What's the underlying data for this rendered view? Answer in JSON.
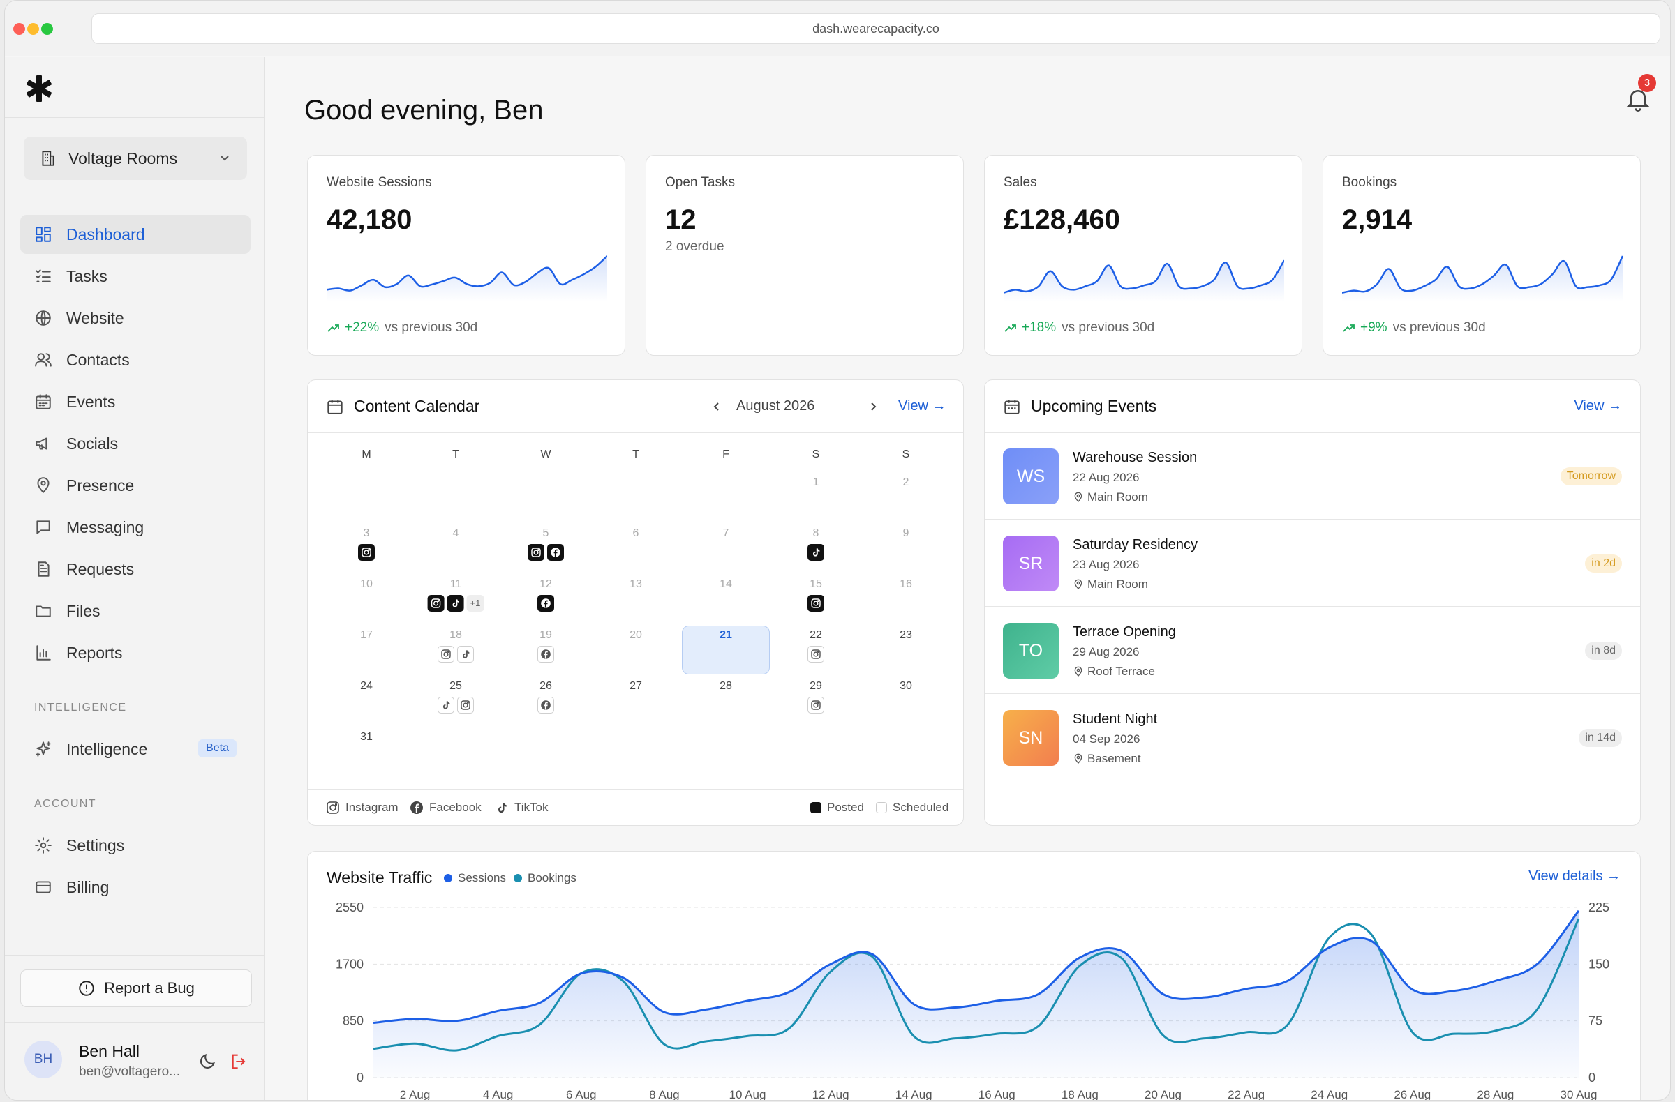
{
  "browser": {
    "url": "dash.wearecapacity.co"
  },
  "sidebar": {
    "workspace": "Voltage Rooms",
    "nav": [
      {
        "label": "Dashboard",
        "icon": "dashboard-icon",
        "active": true
      },
      {
        "label": "Tasks",
        "icon": "tasks-icon"
      },
      {
        "label": "Website",
        "icon": "globe-icon"
      },
      {
        "label": "Contacts",
        "icon": "users-icon"
      },
      {
        "label": "Events",
        "icon": "calendar-icon"
      },
      {
        "label": "Socials",
        "icon": "megaphone-icon"
      },
      {
        "label": "Presence",
        "icon": "map-pin-icon"
      },
      {
        "label": "Messaging",
        "icon": "message-icon"
      },
      {
        "label": "Requests",
        "icon": "document-icon"
      },
      {
        "label": "Files",
        "icon": "folder-icon"
      },
      {
        "label": "Reports",
        "icon": "bar-chart-icon"
      }
    ],
    "intelligence_heading": "INTELLIGENCE",
    "intelligence": {
      "label": "Intelligence",
      "badge": "Beta",
      "icon": "sparkle-icon"
    },
    "account_heading": "ACCOUNT",
    "account": [
      {
        "label": "Settings",
        "icon": "gear-icon"
      },
      {
        "label": "Billing",
        "icon": "credit-card-icon"
      }
    ],
    "report_bug": "Report a Bug",
    "user": {
      "initials": "BH",
      "name": "Ben Hall",
      "email": "ben@voltagero..."
    }
  },
  "header": {
    "greeting": "Good evening, Ben",
    "notifications": "3"
  },
  "kpis": [
    {
      "label": "Website Sessions",
      "value": "42,180",
      "change": "+22%",
      "suffix": "vs previous 30d",
      "spark": [
        0.22,
        0.25,
        0.2,
        0.32,
        0.45,
        0.28,
        0.35,
        0.55,
        0.3,
        0.34,
        0.42,
        0.5,
        0.35,
        0.3,
        0.38,
        0.62,
        0.33,
        0.4,
        0.6,
        0.72,
        0.35,
        0.45,
        0.58,
        0.75,
        1.0
      ]
    },
    {
      "label": "Open Tasks",
      "value": "12",
      "sub": "2 overdue"
    },
    {
      "label": "Sales",
      "value": "£128,460",
      "change": "+18%",
      "suffix": "vs previous 30d",
      "spark": [
        0.15,
        0.22,
        0.18,
        0.3,
        0.65,
        0.3,
        0.22,
        0.3,
        0.42,
        0.78,
        0.3,
        0.25,
        0.32,
        0.42,
        0.82,
        0.3,
        0.25,
        0.3,
        0.45,
        0.85,
        0.3,
        0.25,
        0.32,
        0.45,
        0.9
      ]
    },
    {
      "label": "Bookings",
      "value": "2,914",
      "change": "+9%",
      "suffix": "vs previous 30d",
      "spark": [
        0.15,
        0.2,
        0.18,
        0.35,
        0.7,
        0.25,
        0.2,
        0.3,
        0.45,
        0.75,
        0.3,
        0.25,
        0.35,
        0.55,
        0.8,
        0.3,
        0.28,
        0.35,
        0.58,
        0.88,
        0.3,
        0.28,
        0.32,
        0.45,
        1.0
      ]
    }
  ],
  "calendar": {
    "title": "Content Calendar",
    "month": "August 2026",
    "view": "View",
    "days_of_week": [
      "M",
      "T",
      "W",
      "T",
      "F",
      "S",
      "S"
    ],
    "today": 21,
    "posts": {
      "3": {
        "posted": [
          "instagram"
        ]
      },
      "5": {
        "posted": [
          "instagram",
          "facebook"
        ]
      },
      "8": {
        "posted": [
          "tiktok"
        ]
      },
      "11": {
        "posted": [
          "instagram",
          "tiktok"
        ],
        "more": "+1"
      },
      "12": {
        "posted": [
          "facebook"
        ]
      },
      "15": {
        "posted": [
          "instagram"
        ]
      },
      "18": {
        "scheduled": [
          "instagram",
          "tiktok"
        ]
      },
      "19": {
        "scheduled": [
          "facebook"
        ]
      },
      "22": {
        "scheduled": [
          "instagram"
        ]
      },
      "25": {
        "scheduled": [
          "tiktok",
          "instagram"
        ]
      },
      "26": {
        "scheduled": [
          "facebook"
        ]
      },
      "29": {
        "scheduled": [
          "instagram"
        ]
      }
    },
    "legend": {
      "instagram": "Instagram",
      "facebook": "Facebook",
      "tiktok": "TikTok",
      "posted": "Posted",
      "scheduled": "Scheduled"
    }
  },
  "events": {
    "title": "Upcoming Events",
    "view": "View",
    "items": [
      {
        "initials": "WS",
        "name": "Warehouse Session",
        "date": "22 Aug 2026",
        "location": "Main Room",
        "badge": "Tomorrow",
        "color": "#6f8ef7"
      },
      {
        "initials": "SR",
        "name": "Saturday Residency",
        "date": "23 Aug 2026",
        "location": "Main Room",
        "badge": "in 2d",
        "color": "#a66cf3"
      },
      {
        "initials": "TO",
        "name": "Terrace Opening",
        "date": "29 Aug 2026",
        "location": "Roof Terrace",
        "badge": "in 8d",
        "color": "#4dbf9a"
      },
      {
        "initials": "SN",
        "name": "Student Night",
        "date": "04 Sep 2026",
        "location": "Basement",
        "badge": "in 14d",
        "color": "#f59a4c"
      }
    ]
  },
  "traffic": {
    "title": "Website Traffic",
    "view_details": "View details",
    "chart_data": {
      "type": "line",
      "x": [
        "1 Aug",
        "2 Aug",
        "3 Aug",
        "4 Aug",
        "5 Aug",
        "6 Aug",
        "7 Aug",
        "8 Aug",
        "9 Aug",
        "10 Aug",
        "11 Aug",
        "12 Aug",
        "13 Aug",
        "14 Aug",
        "15 Aug",
        "16 Aug",
        "17 Aug",
        "18 Aug",
        "19 Aug",
        "20 Aug",
        "21 Aug",
        "22 Aug",
        "23 Aug",
        "24 Aug",
        "25 Aug",
        "26 Aug",
        "27 Aug",
        "28 Aug",
        "29 Aug",
        "30 Aug"
      ],
      "tick_labels": [
        "2 Aug",
        "4 Aug",
        "6 Aug",
        "8 Aug",
        "10 Aug",
        "12 Aug",
        "14 Aug",
        "16 Aug",
        "18 Aug",
        "20 Aug",
        "22 Aug",
        "24 Aug",
        "26 Aug",
        "28 Aug",
        "30 Aug"
      ],
      "series": [
        {
          "name": "Sessions",
          "axis": "left",
          "color": "#1d5fe6",
          "values": [
            820,
            880,
            850,
            1000,
            1120,
            1560,
            1500,
            980,
            1020,
            1150,
            1280,
            1700,
            1850,
            1100,
            1050,
            1150,
            1250,
            1800,
            1900,
            1250,
            1200,
            1330,
            1450,
            1950,
            2050,
            1320,
            1300,
            1450,
            1700,
            2500
          ]
        },
        {
          "name": "Bookings",
          "axis": "right",
          "color": "#1a8fb0",
          "values": [
            38,
            45,
            36,
            55,
            70,
            138,
            128,
            44,
            48,
            55,
            65,
            140,
            160,
            55,
            52,
            58,
            68,
            148,
            158,
            56,
            52,
            60,
            70,
            185,
            190,
            60,
            58,
            62,
            90,
            210
          ]
        }
      ],
      "y_left": {
        "ticks": [
          0,
          850,
          1700,
          2550
        ],
        "range": [
          0,
          2550
        ]
      },
      "y_right": {
        "ticks": [
          0,
          75,
          150,
          225
        ],
        "range": [
          0,
          225
        ]
      },
      "grid": true,
      "legend": "top-left"
    }
  }
}
